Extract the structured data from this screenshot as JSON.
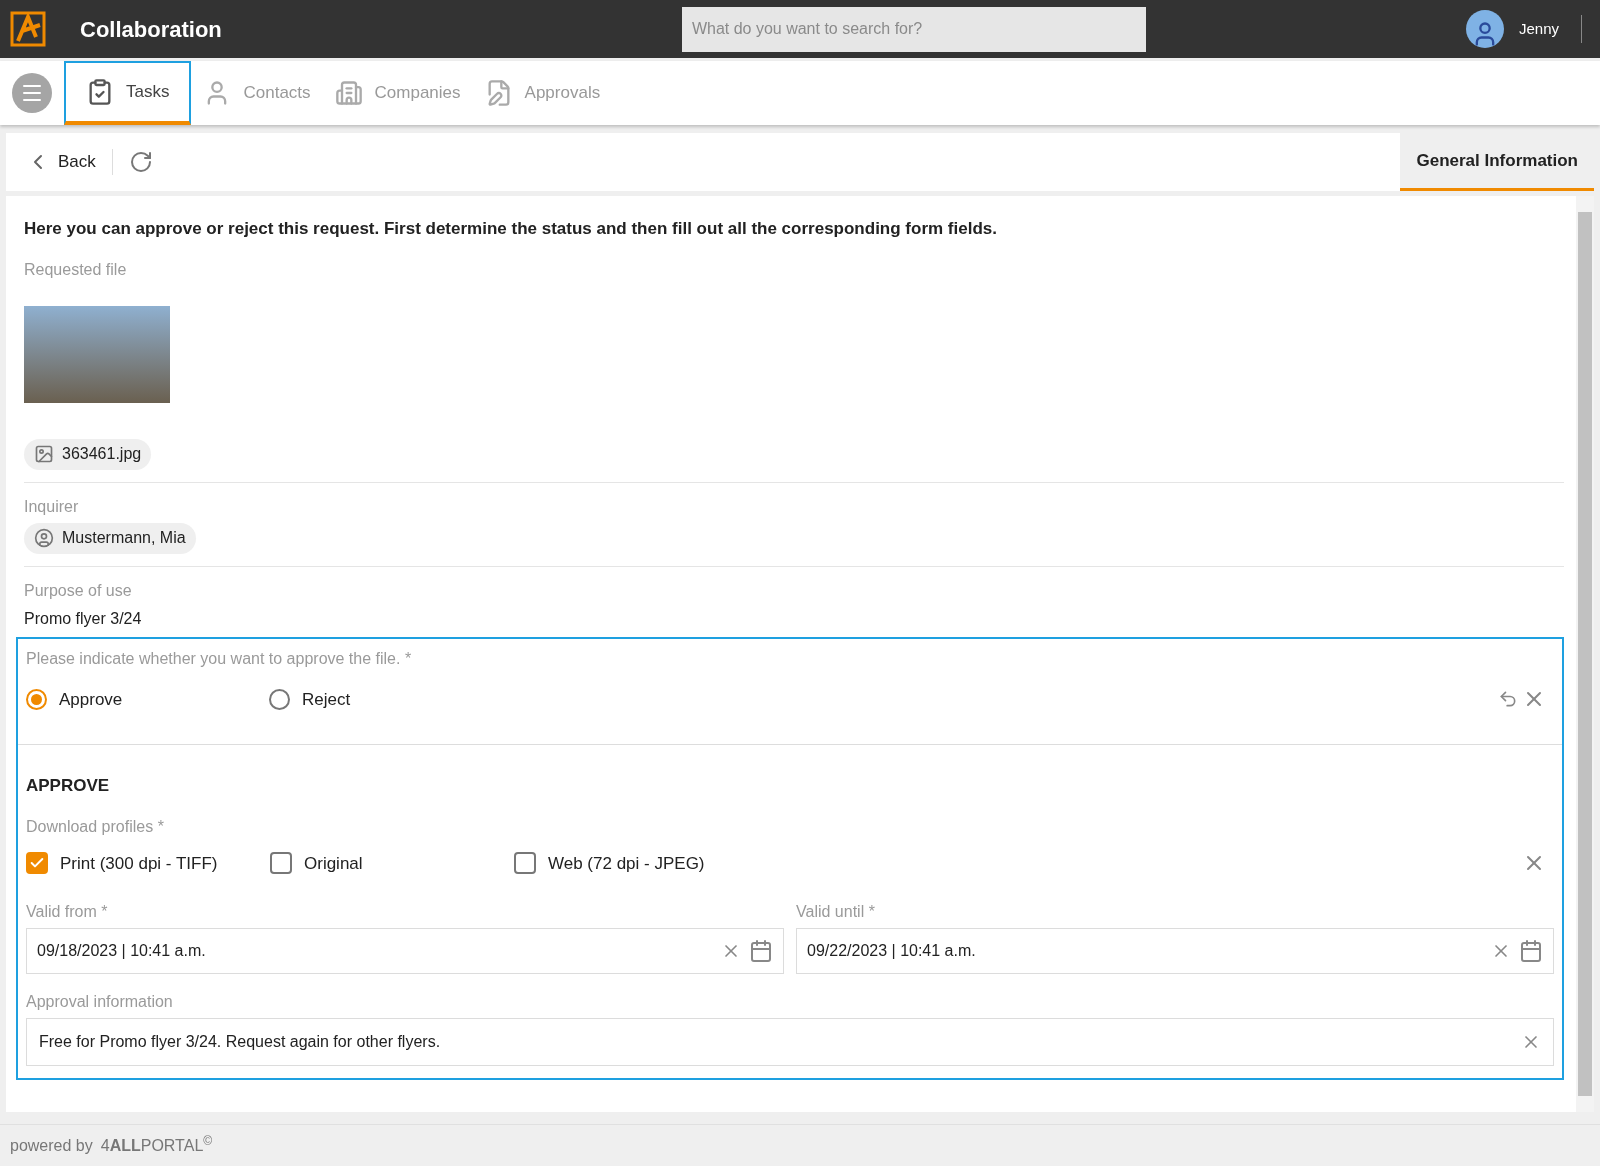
{
  "header": {
    "title": "Collaboration",
    "search": {
      "placeholder": "What do you want to search for?"
    },
    "user": "Jenny"
  },
  "nav_tabs": [
    {
      "label": "Tasks",
      "kind": "tasks",
      "selected": true
    },
    {
      "label": "Contacts",
      "kind": "contacts",
      "selected": false
    },
    {
      "label": "Companies",
      "kind": "companies",
      "selected": false
    },
    {
      "label": "Approvals",
      "kind": "approvals",
      "selected": false
    }
  ],
  "toolbar": {
    "back": "Back",
    "panel_tab": {
      "label": "General Information",
      "selected": true
    }
  },
  "form": {
    "intro": "Here you can approve or reject this request. First determine the status and then fill out all the corresponding form fields.",
    "requested_file_label": "Requested file",
    "file_name": "363461.jpg",
    "inquirer_label": "Inquirer",
    "inquirer": "Mustermann, Mia",
    "purpose_label": "Purpose of use",
    "purpose": "Promo flyer 3/24",
    "decision_label": "Please indicate whether you want to approve the file. *",
    "decision_options": [
      {
        "label": "Approve",
        "selected": true
      },
      {
        "label": "Reject",
        "selected": false
      }
    ],
    "section_title": "APPROVE",
    "profiles_label": "Download profiles *",
    "profiles": [
      {
        "label": "Print (300 dpi - TIFF)",
        "checked": true
      },
      {
        "label": "Original",
        "checked": false
      },
      {
        "label": "Web (72 dpi - JPEG)",
        "checked": false
      }
    ],
    "valid_from": {
      "label": "Valid from *",
      "value": "09/18/2023 | 10:41 a.m."
    },
    "valid_until": {
      "label": "Valid until *",
      "value": "09/22/2023 | 10:41 a.m."
    },
    "approval_info": {
      "label": "Approval information",
      "value": "Free for Promo flyer 3/24. Request again for other flyers."
    }
  },
  "footer": {
    "powered_by": "powered by",
    "brand": "4**ALL**PORTAL$^{©}$"
  }
}
